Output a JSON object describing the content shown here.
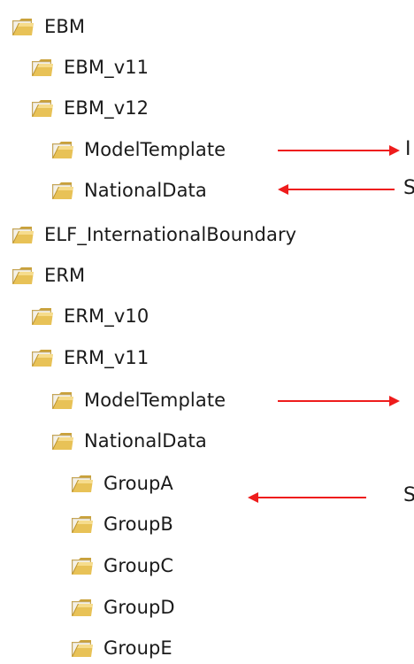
{
  "tree": {
    "items": [
      {
        "label": "EBM"
      },
      {
        "label": "EBM_v11"
      },
      {
        "label": "EBM_v12"
      },
      {
        "label": "ModelTemplate"
      },
      {
        "label": "NationalData"
      },
      {
        "label": "ELF_InternationalBoundary"
      },
      {
        "label": "ERM"
      },
      {
        "label": "ERM_v10"
      },
      {
        "label": "ERM_v11"
      },
      {
        "label": "ModelTemplate"
      },
      {
        "label": "NationalData"
      },
      {
        "label": "GroupA"
      },
      {
        "label": "GroupB"
      },
      {
        "label": "GroupC"
      },
      {
        "label": "GroupD"
      },
      {
        "label": "GroupE"
      }
    ]
  },
  "annotations": {
    "edge_glyphs": [
      "I",
      "S",
      "S"
    ],
    "arrow_color": "#ee1c1c"
  },
  "icons": {
    "folder": "folder-icon"
  }
}
